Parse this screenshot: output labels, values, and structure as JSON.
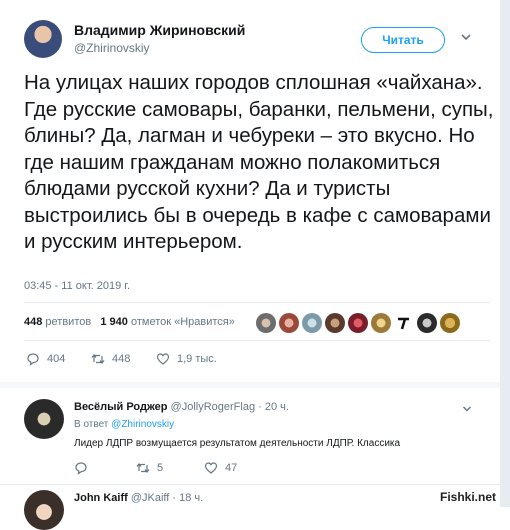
{
  "tweet": {
    "author_name": "Владимир Жириновский",
    "author_handle": "@Zhirinovskiy",
    "follow_label": "Читать",
    "text": "На улицах наших городов сплошная «чайхана». Где русские самовары, баранки, пельмени, супы, блины? Да, лагман и чебуреки – это вкусно. Но где нашим гражданам можно полакомиться блюдами русской кухни? Да и туристы выстроились бы в очередь в кафе с самоварами и русским интерьером.",
    "timestamp": "03:45 - 11 окт. 2019 г.",
    "retweets_count": "448",
    "retweets_label": "ретвитов",
    "likes_count": "1 940",
    "likes_label": "отметок «Нравится»",
    "reply_count": "404",
    "retweet_count": "448",
    "like_count": "1,9 тыс."
  },
  "reply": {
    "author_name": "Весёлый Роджер",
    "author_handle": "@JollyRogerFlag",
    "time": "· 20 ч.",
    "in_reply_prefix": "В ответ",
    "in_reply_to": "@Zhirinovskiy",
    "text": "Лидер ЛДПР возмущается результатом деятельности ЛДПР. Классика",
    "retweet_count": "5",
    "like_count": "47"
  },
  "reply2": {
    "author_name": "John Kaiff",
    "author_handle": "@JKaiff",
    "time": "· 18 ч."
  },
  "watermark": "Fishki.net",
  "colors": {
    "accent": "#1da1f2",
    "muted": "#657786",
    "text": "#14171a",
    "divider": "#e6ecf0"
  },
  "icons": [
    "chevron-down-icon",
    "reply-icon",
    "retweet-icon",
    "heart-icon"
  ]
}
